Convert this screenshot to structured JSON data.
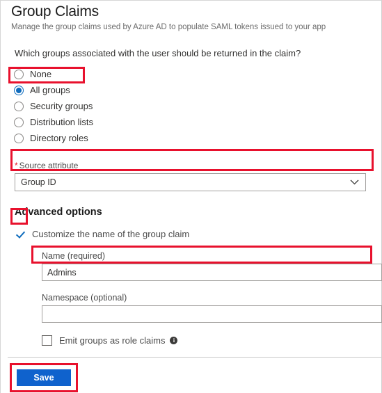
{
  "header": {
    "title": "Group Claims",
    "subtitle": "Manage the group claims used by Azure AD to populate SAML tokens issued to your app"
  },
  "question": "Which groups associated with the user should be returned in the claim?",
  "radio_group": {
    "name": "group-claim-type",
    "selected": "All groups",
    "options": [
      {
        "label": "None",
        "checked": false
      },
      {
        "label": "All groups",
        "checked": true
      },
      {
        "label": "Security groups",
        "checked": false
      },
      {
        "label": "Distribution lists",
        "checked": false
      },
      {
        "label": "Directory roles",
        "checked": false
      }
    ]
  },
  "source_attribute": {
    "required_marker": "*",
    "label": "Source attribute",
    "value": "Group ID",
    "chevron_icon": "chevron-down-icon"
  },
  "advanced_options": {
    "title": "Advanced options",
    "customize_checkbox": {
      "label": "Customize the name of the group claim",
      "checked": true
    },
    "name_field": {
      "label": "Name (required)",
      "value": "Admins",
      "placeholder": ""
    },
    "namespace_field": {
      "label": "Namespace (optional)",
      "value": "",
      "placeholder": ""
    },
    "emit_role_claims_checkbox": {
      "label": "Emit groups as role claims",
      "checked": false,
      "info_icon": "info-icon",
      "info_glyph": "i"
    }
  },
  "footer": {
    "save_label": "Save"
  },
  "colors": {
    "accent_blue": "#0f62cd",
    "radio_blue": "#0f6cbd",
    "annotation_red": "#e8112d",
    "required_red": "#e81123",
    "text_primary": "#323130",
    "text_secondary": "#6b6b6b"
  }
}
